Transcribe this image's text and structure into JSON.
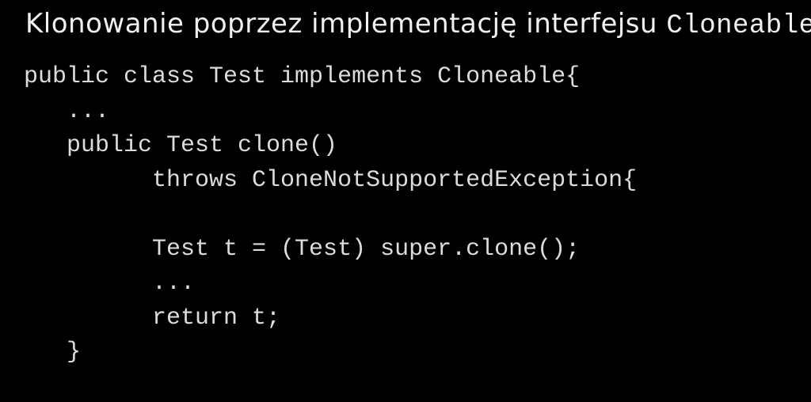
{
  "title": {
    "prefix": "Klonowanie poprzez implementację interfejsu ",
    "code_word": "Cloneable"
  },
  "code": {
    "l1": "public class Test implements Cloneable{",
    "l2": "   ...",
    "l3": "   public Test clone()",
    "l4": "         throws CloneNotSupportedException{",
    "l5": "",
    "l6": "         Test t = (Test) super.clone();",
    "l7": "         ...",
    "l8": "         return t;",
    "l9": "   }"
  }
}
